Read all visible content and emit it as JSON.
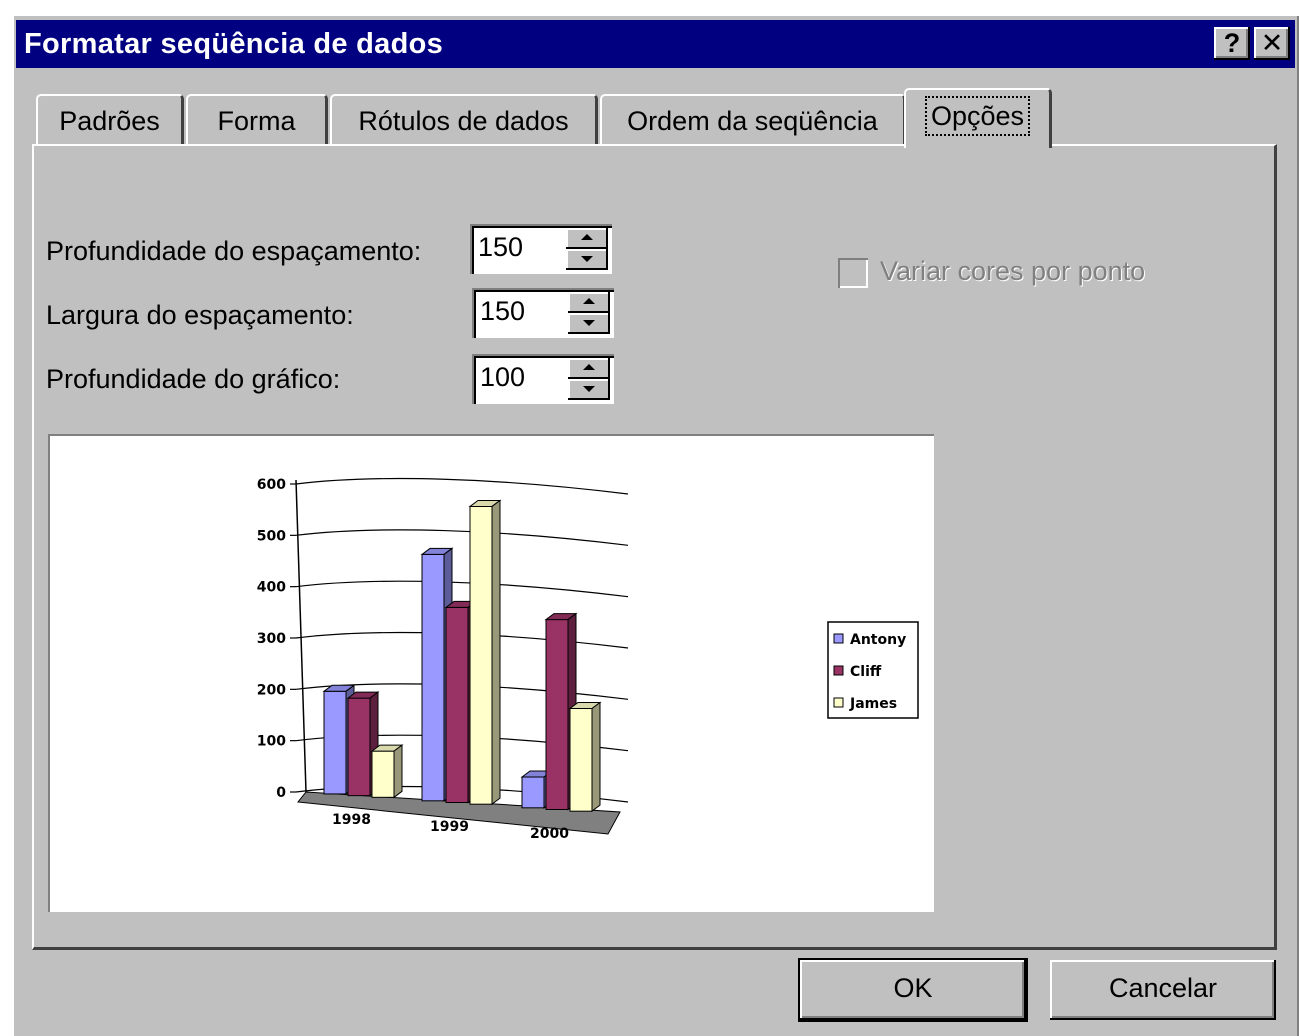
{
  "window": {
    "title": "Formatar seqüência de dados",
    "help_label": "?",
    "close_label": "✕"
  },
  "tabs": [
    {
      "label": "Padrões"
    },
    {
      "label": "Forma"
    },
    {
      "label": "Rótulos de dados"
    },
    {
      "label": "Ordem da seqüência"
    },
    {
      "label": "Opções",
      "active": true
    }
  ],
  "options": {
    "gap_depth_label": "Profundidade do espaçamento:",
    "gap_depth_value": "150",
    "gap_width_label": "Largura do espaçamento:",
    "gap_width_value": "150",
    "chart_depth_label": "Profundidade do gráfico:",
    "chart_depth_value": "100",
    "vary_colors_label": "Variar cores por ponto",
    "vary_colors_checked": false,
    "vary_colors_enabled": false
  },
  "buttons": {
    "ok": "OK",
    "cancel": "Cancelar"
  },
  "chart_data": {
    "type": "bar",
    "categories": [
      "1998",
      "1999",
      "2000"
    ],
    "series": [
      {
        "name": "Antony",
        "values": [
          200,
          480,
          60
        ],
        "color": "#9999ff"
      },
      {
        "name": "Cliff",
        "values": [
          190,
          380,
          370
        ],
        "color": "#993366"
      },
      {
        "name": "James",
        "values": [
          90,
          580,
          200
        ],
        "color": "#ffffcc"
      }
    ],
    "yticks": [
      "0",
      "100",
      "200",
      "300",
      "400",
      "500",
      "600"
    ],
    "ylim": [
      0,
      600
    ],
    "grid": true,
    "legend_position": "right",
    "three_d": true
  }
}
